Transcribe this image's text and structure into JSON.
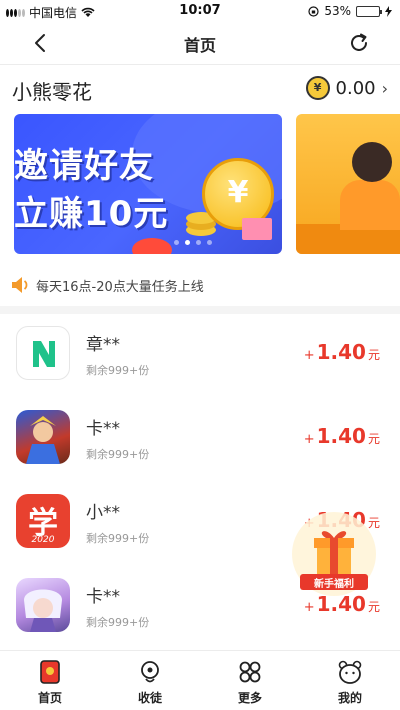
{
  "status_bar": {
    "carrier": "中国电信",
    "time": "10:07",
    "battery": "53%",
    "battery_level": 0.53
  },
  "nav": {
    "title": "首页"
  },
  "brand": {
    "name": "小熊零花",
    "balance": "0.00",
    "coin_symbol": "¥"
  },
  "banner": {
    "line1": "邀请好友",
    "line2": "立赚10元",
    "coin_symbol": "¥",
    "page_count": 4,
    "active_page": 1
  },
  "notice": {
    "text": "每天16点-20点大量任务上线"
  },
  "tasks": [
    {
      "name": "章**",
      "remain": "剩余999+份",
      "plus": "+",
      "reward": "1.40",
      "unit": "元",
      "icon": "n-app-icon"
    },
    {
      "name": "卡**",
      "remain": "剩余999+份",
      "plus": "+",
      "reward": "1.40",
      "unit": "元",
      "icon": "game-app-icon"
    },
    {
      "name": "小**",
      "remain": "剩余999+份",
      "plus": "+",
      "reward": "1.40",
      "unit": "元",
      "icon": "learn-app-icon",
      "icon_text": "学",
      "icon_sub": "2020"
    },
    {
      "name": "卡**",
      "remain": "剩余999+份",
      "plus": "+",
      "reward": "1.40",
      "unit": "元",
      "icon": "anime-app-icon"
    }
  ],
  "promo": {
    "label": "新手福利"
  },
  "tabs": [
    {
      "label": "首页",
      "icon": "home-icon"
    },
    {
      "label": "收徒",
      "icon": "apprentice-icon"
    },
    {
      "label": "更多",
      "icon": "more-icon"
    },
    {
      "label": "我的",
      "icon": "profile-icon"
    }
  ]
}
